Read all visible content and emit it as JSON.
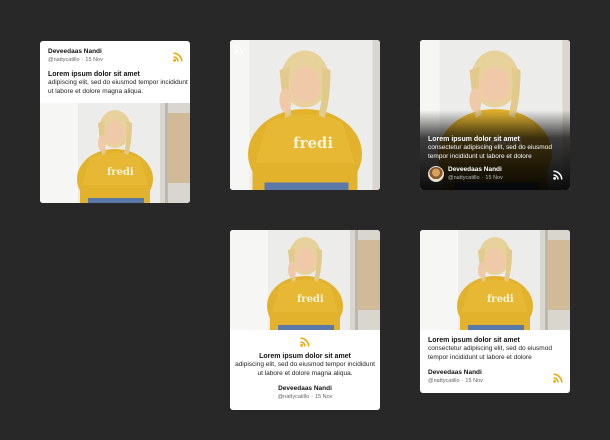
{
  "post": {
    "author_name": "Deveedaas Nandi",
    "handle": "@nattycatillo",
    "separator": "·",
    "date": "15 Nov",
    "title": "Lorem ipsum dolor sit amet",
    "body_short": "adipiscing elit, sed do eiusmod tempor incididunt ut labore et dolore magna aliqua.",
    "body_long": "consectetur adipiscing elit, sed do eiusmod tempor incididunt ut labore et dolore"
  },
  "icons": {
    "feed": "rss-icon",
    "avatar": "avatar"
  },
  "colors": {
    "background": "#282828",
    "card": "#ffffff",
    "rss_accent": "#f0a500",
    "sweater": "#e3b22c"
  }
}
